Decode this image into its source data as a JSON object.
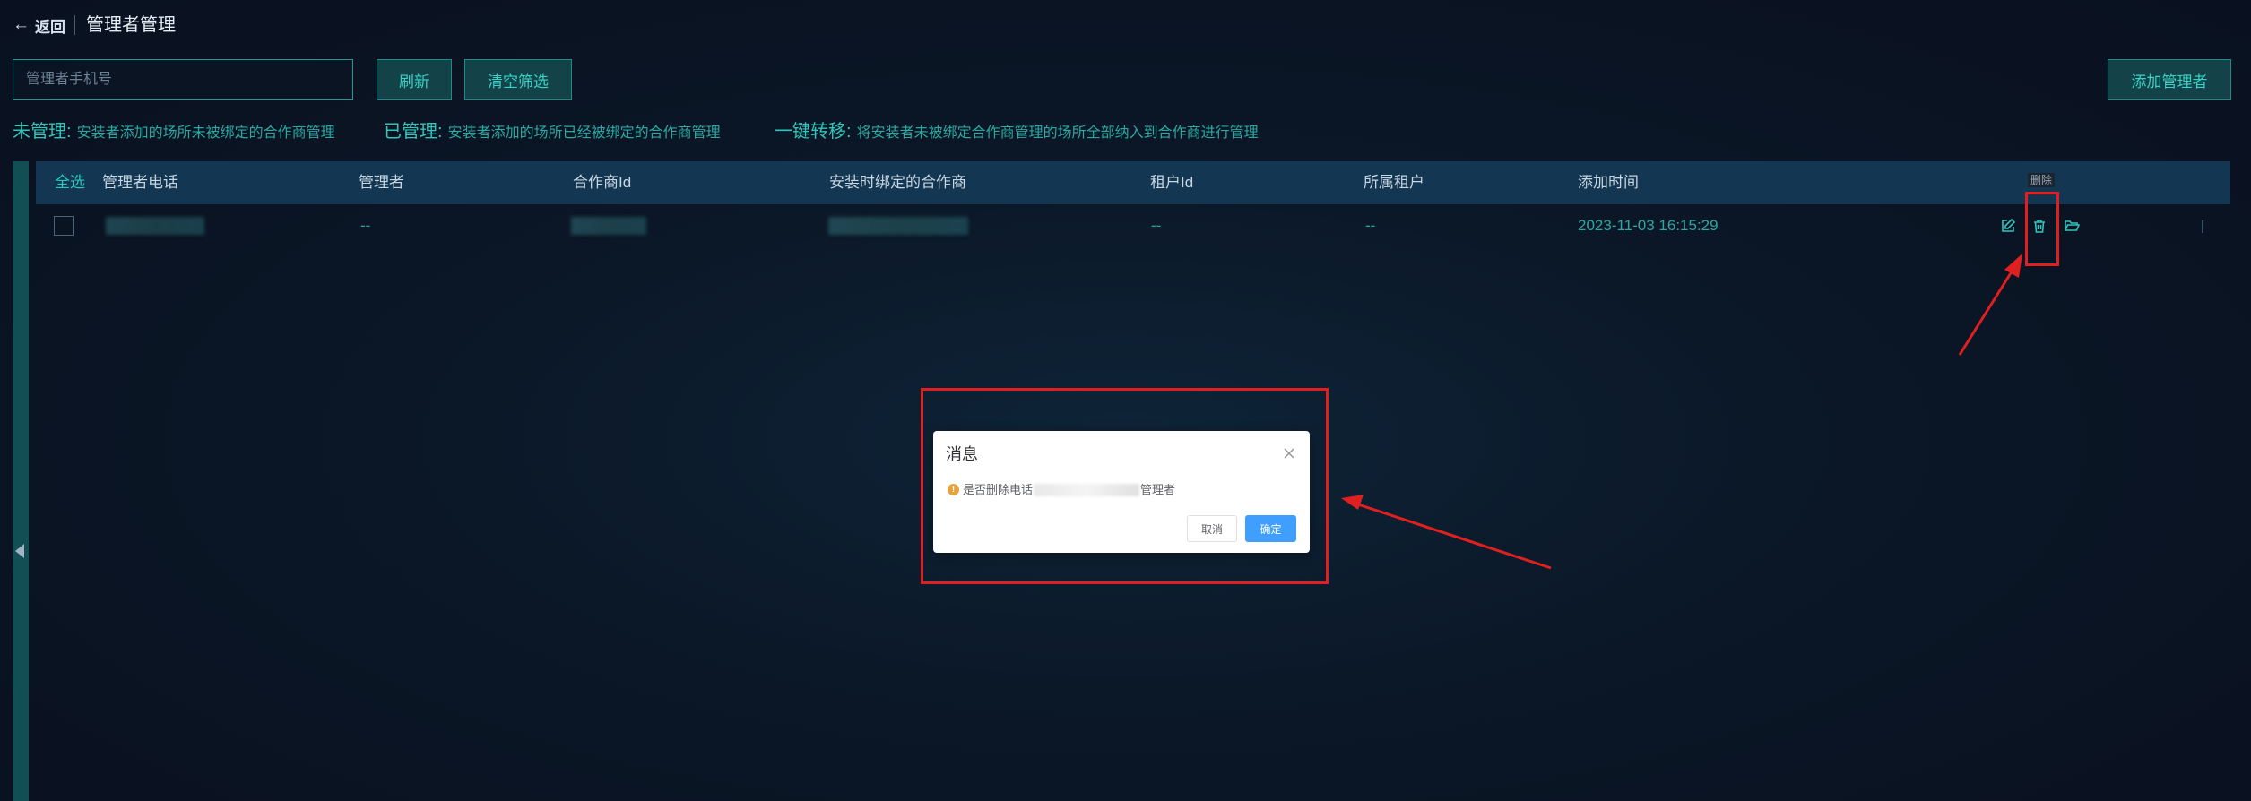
{
  "header": {
    "back_label": "返回",
    "title": "管理者管理"
  },
  "toolbar": {
    "search_placeholder": "管理者手机号",
    "refresh_label": "刷新",
    "clear_label": "清空筛选",
    "add_label": "添加管理者"
  },
  "legend": [
    {
      "key": "未管理:",
      "desc": "安装者添加的场所未被绑定的合作商管理"
    },
    {
      "key": "已管理:",
      "desc": "安装者添加的场所已经被绑定的合作商管理"
    },
    {
      "key": "一键转移:",
      "desc": "将安装者未被绑定合作商管理的场所全部纳入到合作商进行管理"
    }
  ],
  "table": {
    "select_all": "全选",
    "columns": [
      "管理者电话",
      "管理者",
      "合作商Id",
      "安装时绑定的合作商",
      "租户Id",
      "所属租户",
      "添加时间"
    ],
    "rows": [
      {
        "manager": "--",
        "tenant_id": "--",
        "tenant": "--",
        "added_time": "2023-11-03 16:15:29"
      }
    ],
    "delete_tooltip": "删除",
    "icons": [
      "edit-icon",
      "trash-icon",
      "folder-open-icon"
    ]
  },
  "dialog": {
    "title": "消息",
    "message_prefix": "是否删除电话",
    "message_suffix": "管理者",
    "cancel_label": "取消",
    "confirm_label": "确定"
  },
  "colors": {
    "accent": "#2fc6bb",
    "annotation": "#e02020",
    "primary_button": "#409eff",
    "warning": "#e6a23c"
  }
}
